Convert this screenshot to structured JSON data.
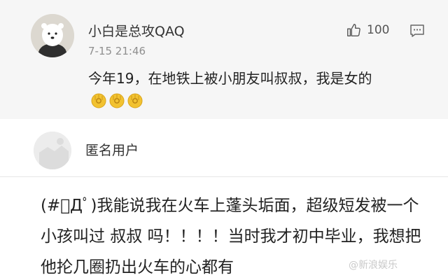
{
  "comment1": {
    "username": "小白是总攻QAQ",
    "timestamp": "7-15 21:46",
    "likes": "100",
    "text": "今年19，在地铁上被小朋友叫叔叔，我是女的",
    "emojis": [
      "ok-hand-emoji",
      "ok-hand-emoji",
      "ok-hand-emoji"
    ]
  },
  "comment2": {
    "username": "匿名用户",
    "text": "(#ﾟДﾟ)我能说我在火车上蓬头垢面，超级短发被一个小孩叫过 叔叔 吗！！！！当时我才初中毕业，我想把他抡几圈扔出火车的心都有"
  },
  "watermark": "@新浪娱乐",
  "colors": {
    "card_background": "#f6f6f6",
    "text": "#222222",
    "secondary_text": "#8f8f8f",
    "emoji": "#f2c230"
  },
  "icons": {
    "like": "thumbs-up-icon",
    "comment": "comment-bubble-icon",
    "avatar1": "polar-bear-avatar",
    "avatar2": "default-anonymous-avatar"
  }
}
